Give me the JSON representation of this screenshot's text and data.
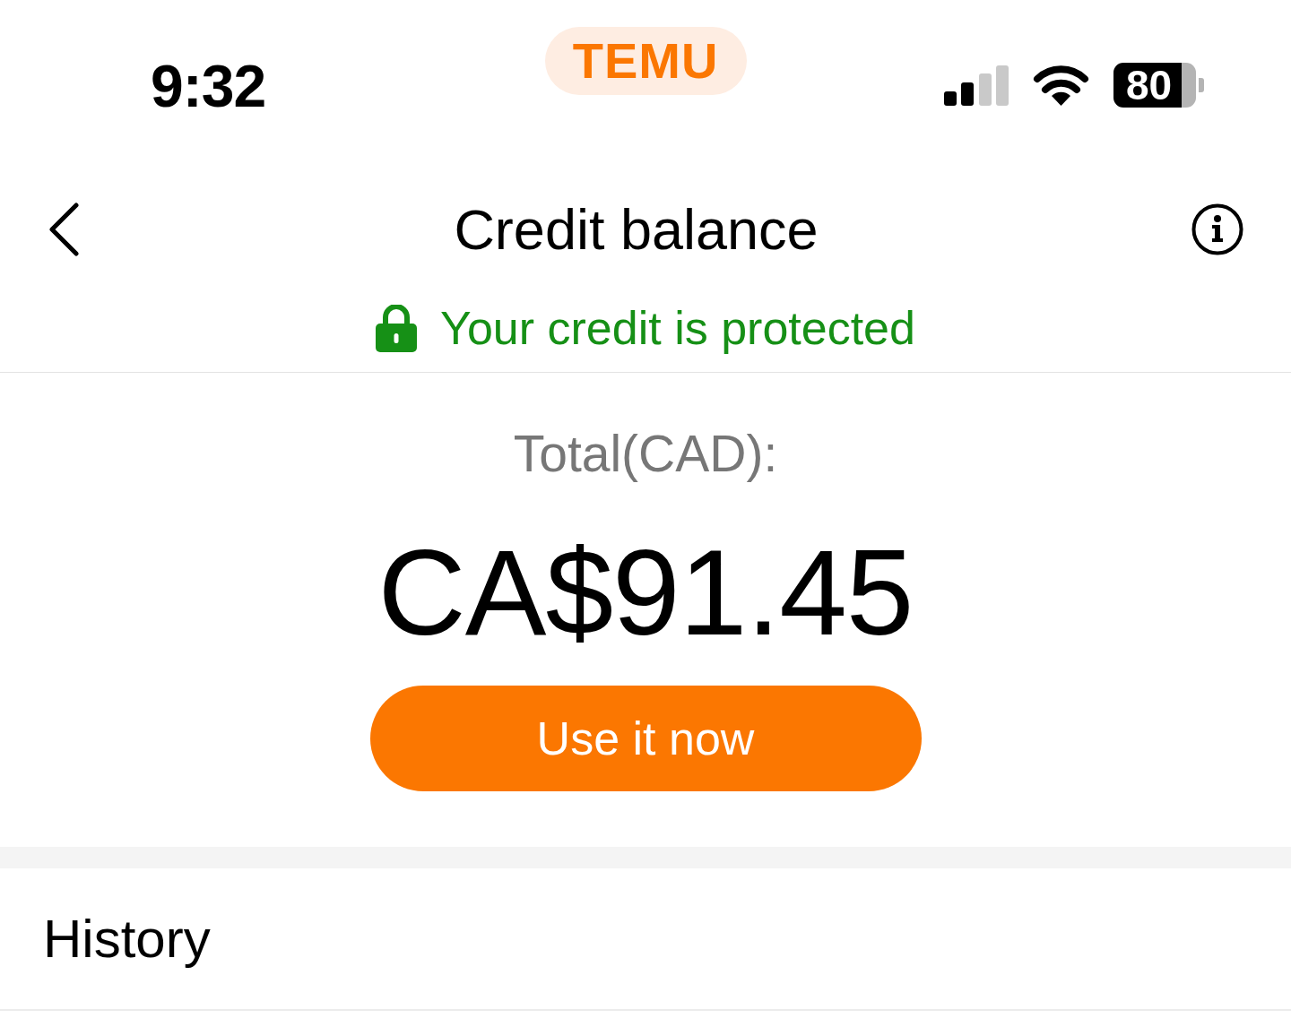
{
  "status_bar": {
    "time": "9:32",
    "app_badge": "TEMU",
    "battery": "80"
  },
  "header": {
    "title": "Credit balance"
  },
  "protection_notice": "Your credit is protected",
  "balance": {
    "label": "Total(CAD):",
    "amount": "CA$91.45"
  },
  "action_button": {
    "label": "Use it now"
  },
  "history": {
    "title": "History"
  }
}
